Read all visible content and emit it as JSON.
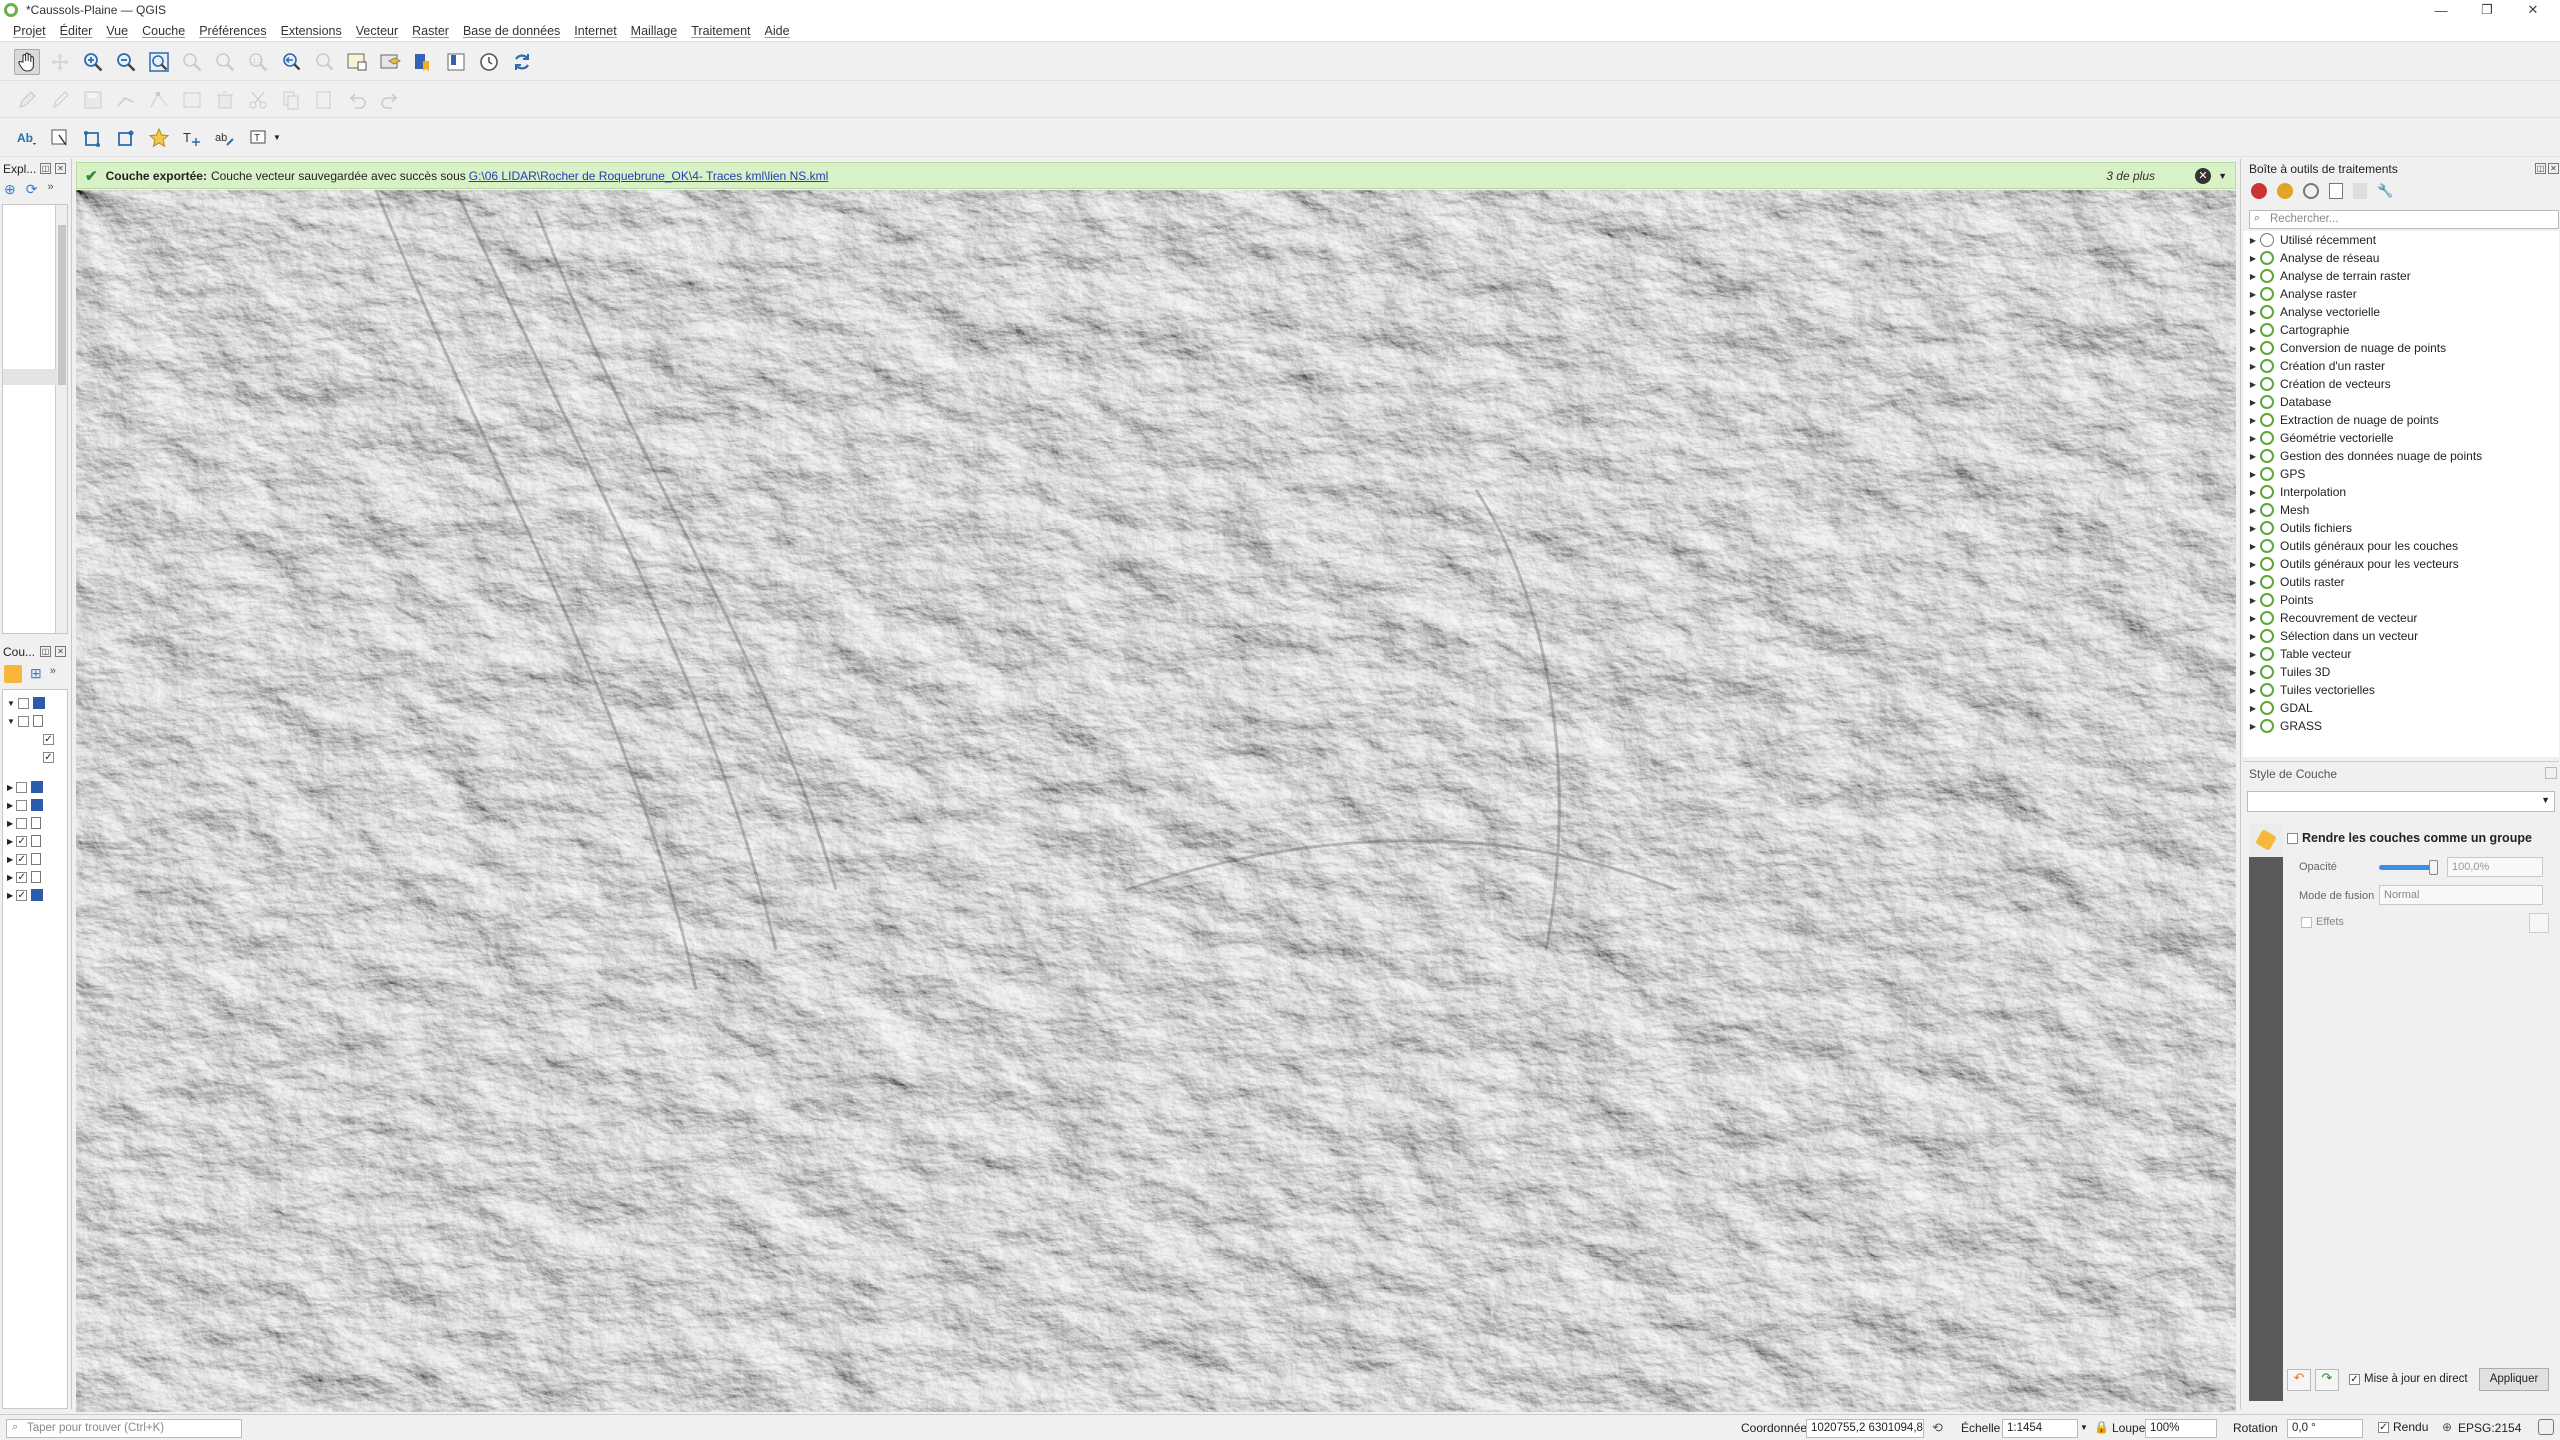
{
  "window": {
    "title": "*Caussols-Plaine — QGIS"
  },
  "menu": [
    "Projet",
    "Éditer",
    "Vue",
    "Couche",
    "Préférences",
    "Extensions",
    "Vecteur",
    "Raster",
    "Base de données",
    "Internet",
    "Maillage",
    "Traitement",
    "Aide"
  ],
  "left": {
    "browser_title": "Expl...",
    "layers_title": "Cou..."
  },
  "message": {
    "label": "Couche exportée:",
    "text": "Couche vecteur sauvegardée avec succès sous",
    "link": "G:\\06 LIDAR\\Rocher de Roquebrune_OK\\4- Traces kml\\lien NS.kml",
    "more": "3 de plus"
  },
  "toolbox": {
    "title": "Boîte à outils de traitements",
    "search_placeholder": "Rechercher...",
    "items": [
      "Utilisé récemment",
      "Analyse de réseau",
      "Analyse de terrain raster",
      "Analyse raster",
      "Analyse vectorielle",
      "Cartographie",
      "Conversion de nuage de points",
      "Création d'un raster",
      "Création de vecteurs",
      "Database",
      "Extraction de nuage de points",
      "Géométrie vectorielle",
      "Gestion des données nuage de points",
      "GPS",
      "Interpolation",
      "Mesh",
      "Outils fichiers",
      "Outils généraux pour les couches",
      "Outils généraux pour les vecteurs",
      "Outils raster",
      "Points",
      "Recouvrement de vecteur",
      "Sélection dans un vecteur",
      "Table vecteur",
      "Tuiles 3D",
      "Tuiles vectorielles",
      "GDAL",
      "GRASS"
    ]
  },
  "style": {
    "title": "Style de Couche",
    "group_render": "Rendre les couches comme un groupe",
    "opacity_label": "Opacité",
    "opacity_value": "100,0%",
    "opacity_fraction": 1.0,
    "blend_label": "Mode de fusion",
    "blend_value": "Normal",
    "effects_label": "Effets",
    "live_update": "Mise à jour en direct",
    "apply": "Appliquer"
  },
  "status": {
    "locator_placeholder": "Taper pour trouver (Ctrl+K)",
    "coord_label": "Coordonnée",
    "coord_value": "1020755,2  6301094,8",
    "scale_label": "Échelle",
    "scale_value": "1:1454",
    "magnifier_label": "Loupe",
    "magnifier_value": "100%",
    "rotation_label": "Rotation",
    "rotation_value": "0,0 °",
    "render_label": "Rendu",
    "crs": "EPSG:2154"
  },
  "colors": {
    "accent": "#6ab04c",
    "message_bg": "#d8f1c7",
    "link": "#1f3fb5"
  }
}
